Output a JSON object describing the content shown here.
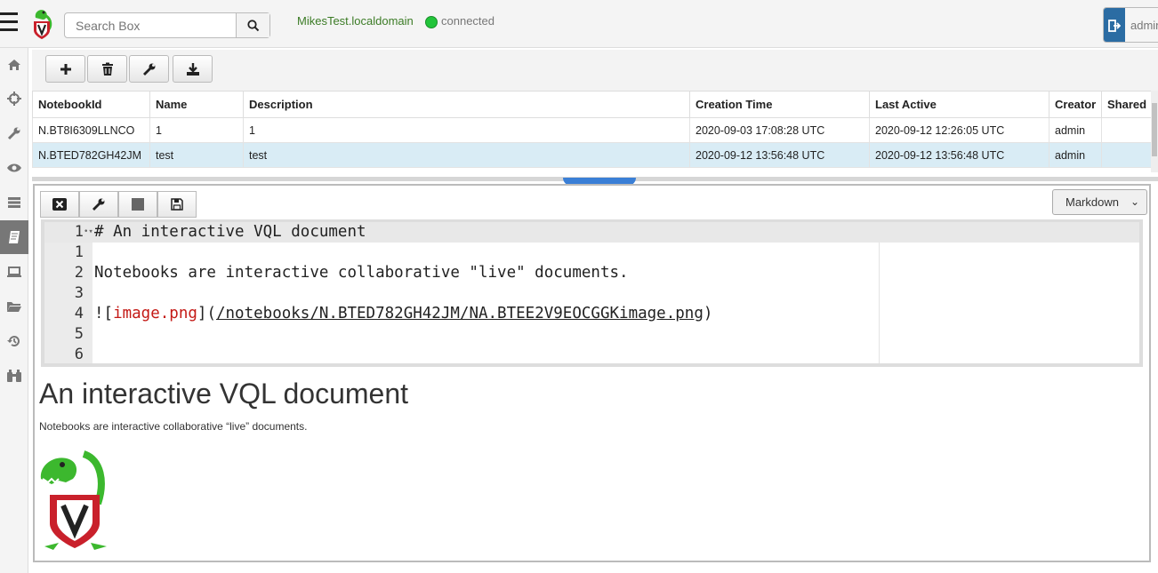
{
  "topbar": {
    "search_placeholder": "Search Box",
    "hostname": "MikesTest.localdomain",
    "status": "connected",
    "user": "admin"
  },
  "sidebar": {
    "items": [
      "home-icon",
      "crosshair-icon",
      "wrench-icon",
      "eye-icon",
      "server-icon",
      "notebook-icon",
      "laptop-icon",
      "folder-icon",
      "history-icon",
      "binoculars-icon"
    ],
    "active": "notebook-icon"
  },
  "toolbar": {
    "buttons": [
      "add-notebook",
      "delete-notebook",
      "edit-notebook",
      "export-notebook"
    ]
  },
  "table": {
    "columns": [
      "NotebookId",
      "Name",
      "Description",
      "Creation Time",
      "Last Active",
      "Creator",
      "Shared"
    ],
    "rows": [
      [
        "N.BT8I6309LLNCO",
        "1",
        "1",
        "2020-09-03 17:08:28 UTC",
        "2020-09-12 12:26:05 UTC",
        "admin",
        ""
      ],
      [
        "N.BTED782GH42JM",
        "test",
        "test",
        "2020-09-12 13:56:48 UTC",
        "2020-09-12 13:56:48 UTC",
        "admin",
        ""
      ]
    ],
    "selected_row": 1
  },
  "cell": {
    "mode": "Markdown",
    "editor_lines": [
      {
        "num": "1",
        "text": "# An interactive VQL document"
      },
      {
        "num": "1",
        "text": ""
      },
      {
        "num": "2",
        "text": "Notebooks are interactive collaborative \"live\" documents."
      },
      {
        "num": "3",
        "text": ""
      },
      {
        "num": "4",
        "prefix": "![",
        "red": "image.png",
        "mid": "](",
        "link": "/notebooks/N.BTED782GH42JM/NA.BTEE2V9EOCGGKimage.png",
        "suffix": ")"
      },
      {
        "num": "5",
        "text": ""
      },
      {
        "num": "6",
        "text": ""
      }
    ],
    "rendered": {
      "heading": "An interactive VQL document",
      "paragraph": "Notebooks are interactive collaborative “live” documents."
    }
  },
  "colors": {
    "accent": "#2b6ca3",
    "connected": "#22c43a",
    "hostname": "#3b7b25",
    "selected_row": "#d9ecf5"
  }
}
